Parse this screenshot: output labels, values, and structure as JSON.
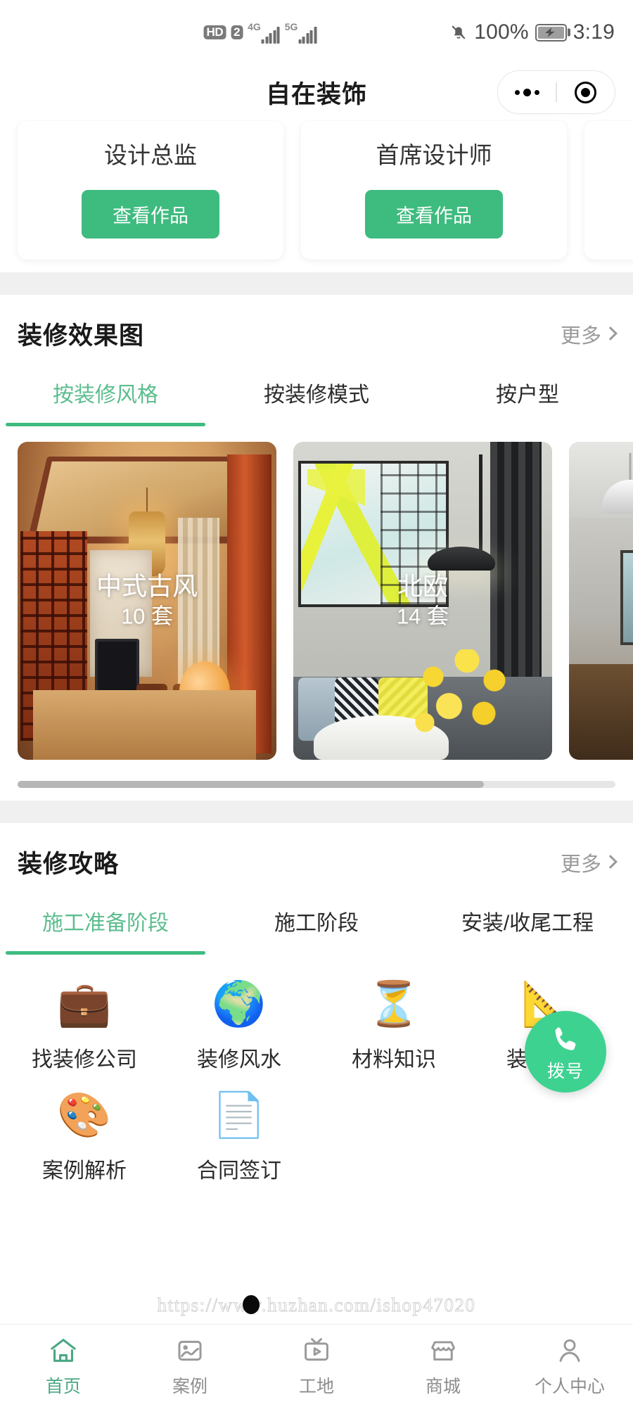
{
  "status_bar": {
    "hd_badge": "HD",
    "sim_badge": "2",
    "network_1": "4G",
    "network_2": "5G",
    "mute_icon": "bell-muted-icon",
    "battery_percent": "100%",
    "battery_icon": "battery-charging-icon",
    "time": "3:19"
  },
  "header": {
    "title": "自在装饰",
    "capsule": {
      "menu_icon": "more-dots-icon",
      "target_icon": "target-circle-icon"
    }
  },
  "designers": {
    "cards": [
      {
        "name": "设计总监",
        "button_label": "查看作品"
      },
      {
        "name": "首席设计师",
        "button_label": "查看作品"
      },
      {
        "name": "",
        "button_label": ""
      }
    ]
  },
  "renderings_section": {
    "title": "装修效果图",
    "more_label": "更多",
    "more_icon": "chevron-right-icon",
    "tabs": [
      {
        "label": "按装修风格",
        "active": true
      },
      {
        "label": "按装修模式",
        "active": false
      },
      {
        "label": "按户型",
        "active": false
      }
    ],
    "cards": [
      {
        "name": "中式古风",
        "count": "10 套",
        "scene": "chinese-traditional-room"
      },
      {
        "name": "北欧",
        "count": "14 套",
        "scene": "nordic-living-room"
      },
      {
        "name": "",
        "count": "",
        "scene": "dining-kitchen-room"
      }
    ]
  },
  "guides_section": {
    "title": "装修攻略",
    "more_label": "更多",
    "more_icon": "chevron-right-icon",
    "tabs": [
      {
        "label": "施工准备阶段",
        "active": true
      },
      {
        "label": "施工阶段",
        "active": false
      },
      {
        "label": "安装/收尾工程",
        "active": false
      }
    ],
    "items": [
      {
        "label": "找装修公司",
        "emoji": "💼",
        "icon": "briefcase-icon"
      },
      {
        "label": "装修风水",
        "emoji": "🌍",
        "icon": "globe-icon"
      },
      {
        "label": "材料知识",
        "emoji": "⏳",
        "icon": "hourglass-icon"
      },
      {
        "label": "装修经验",
        "emoji": "📐",
        "icon": "triangle-ruler-icon"
      },
      {
        "label": "案例解析",
        "emoji": "🎨",
        "icon": "palette-icon"
      },
      {
        "label": "合同签订",
        "emoji": "📄",
        "icon": "document-icon"
      }
    ]
  },
  "dial_fab": {
    "label": "拨号",
    "icon": "phone-icon"
  },
  "watermark": {
    "text": "https://www.huzhan.com/ishop47020"
  },
  "tabbar": {
    "items": [
      {
        "label": "首页",
        "icon": "home-icon",
        "active": true
      },
      {
        "label": "案例",
        "icon": "image-icon",
        "active": false
      },
      {
        "label": "工地",
        "icon": "video-play-icon",
        "active": false
      },
      {
        "label": "商城",
        "icon": "shop-icon",
        "active": false
      },
      {
        "label": "个人中心",
        "icon": "person-icon",
        "active": false
      }
    ]
  },
  "colors": {
    "accent_green": "#3ebb7f",
    "tab_active_green": "#5cbd8e",
    "fab_green": "#3ed291",
    "gap_gray": "#f0f0f0"
  }
}
